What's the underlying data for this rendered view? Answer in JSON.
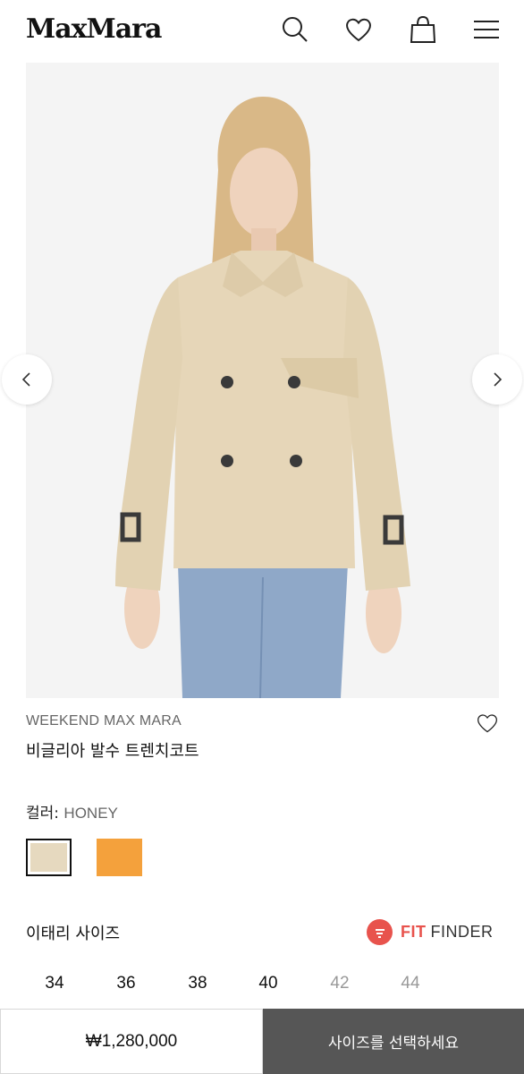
{
  "header": {
    "logo": "MaxMara",
    "icons": [
      "search-icon",
      "heart-icon",
      "bag-icon",
      "menu-icon"
    ]
  },
  "gallery": {
    "prev_icon": "chevron-left-icon",
    "next_icon": "chevron-right-icon"
  },
  "product": {
    "brand": "WEEKEND MAX MARA",
    "name": "비글리아 발수 트렌치코트",
    "wishlist_icon": "heart-outline-icon"
  },
  "color": {
    "label": "컬러: ",
    "value": "HONEY",
    "swatches": [
      {
        "name": "HONEY",
        "hex": "#e6d9bf",
        "selected": true
      },
      {
        "name": "orange",
        "hex": "#f4a13c",
        "selected": false
      }
    ]
  },
  "size": {
    "title": "이태리 사이즈",
    "fit_finder_a": "FIT",
    "fit_finder_b": "FINDER",
    "options": [
      {
        "label": "34",
        "available": true
      },
      {
        "label": "36",
        "available": true
      },
      {
        "label": "38",
        "available": true
      },
      {
        "label": "40",
        "available": true
      },
      {
        "label": "42",
        "available": false
      },
      {
        "label": "44",
        "available": false
      }
    ]
  },
  "footer": {
    "price": "₩1,280,000",
    "cta": "사이즈를 선택하세요"
  }
}
